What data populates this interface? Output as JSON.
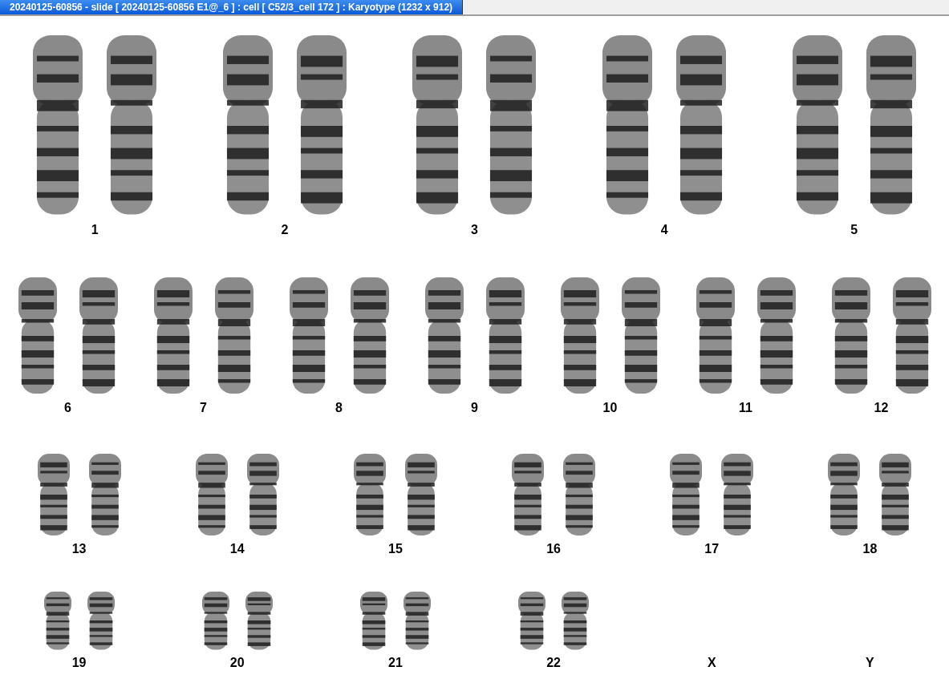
{
  "window": {
    "title": "20240125-60856 - slide [ 20240125-60856 E1@_6 ] : cell [ C52/3_cell 172 ] : Karyotype  (1232 x 912)"
  },
  "karyotype": {
    "rows": [
      [
        {
          "label": "1",
          "kind": "pair"
        },
        {
          "label": "2",
          "kind": "pair"
        },
        {
          "label": "3",
          "kind": "pair"
        },
        {
          "label": "4",
          "kind": "pair"
        },
        {
          "label": "5",
          "kind": "pair"
        }
      ],
      [
        {
          "label": "6",
          "kind": "pair"
        },
        {
          "label": "7",
          "kind": "pair"
        },
        {
          "label": "8",
          "kind": "pair"
        },
        {
          "label": "9",
          "kind": "pair"
        },
        {
          "label": "10",
          "kind": "pair"
        },
        {
          "label": "11",
          "kind": "pair"
        },
        {
          "label": "12",
          "kind": "pair"
        }
      ],
      [
        {
          "label": "13",
          "kind": "pair"
        },
        {
          "label": "14",
          "kind": "pair"
        },
        {
          "label": "15",
          "kind": "pair"
        },
        {
          "label": "16",
          "kind": "pair"
        },
        {
          "label": "17",
          "kind": "pair"
        },
        {
          "label": "18",
          "kind": "pair"
        }
      ],
      [
        {
          "label": "19",
          "kind": "pair"
        },
        {
          "label": "20",
          "kind": "pair"
        },
        {
          "label": "21",
          "kind": "pair"
        },
        {
          "label": "22",
          "kind": "pair"
        },
        {
          "label": "X",
          "kind": "empty"
        },
        {
          "label": "Y",
          "kind": "empty"
        }
      ]
    ]
  }
}
